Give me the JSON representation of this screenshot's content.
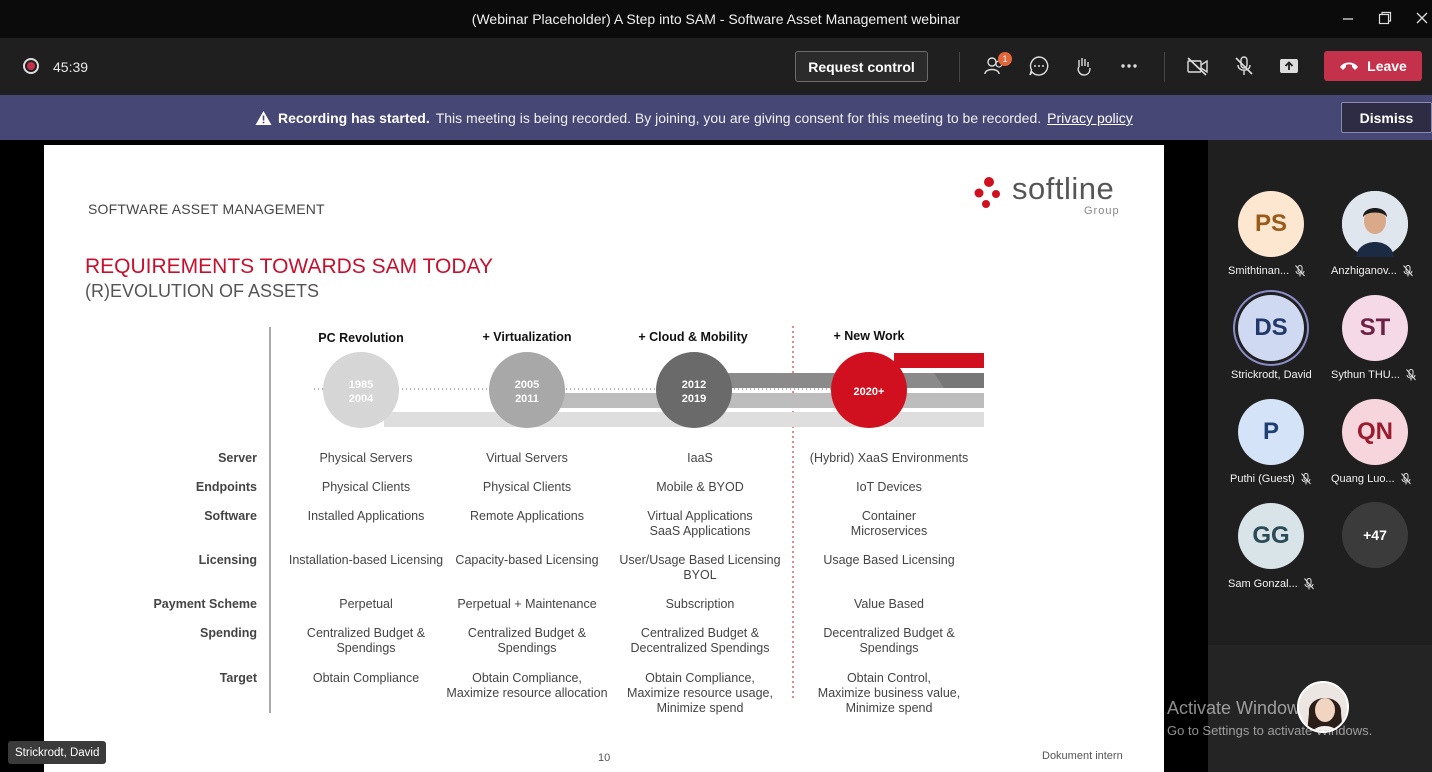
{
  "window": {
    "title": "(Webinar Placeholder) A Step into SAM - Software Asset Management webinar"
  },
  "toolbar": {
    "timer": "45:39",
    "request_control": "Request control",
    "participants_badge": "1",
    "leave": "Leave"
  },
  "banner": {
    "bold": "Recording has started.",
    "text": "This meeting is being recorded. By joining, you are giving consent for this meeting to be recorded.",
    "privacy": "Privacy policy",
    "dismiss": "Dismiss"
  },
  "slide": {
    "header": "SOFTWARE ASSET MANAGEMENT",
    "logo_word": "softline",
    "logo_sub": "Group",
    "title": "REQUIREMENTS TOWARDS SAM TODAY",
    "subtitle": "(R)EVOLUTION OF ASSETS",
    "eras": [
      {
        "head": "PC Revolution",
        "years": [
          "1985",
          "2004"
        ],
        "color": "#d6d6d6"
      },
      {
        "head": "+ Virtualization",
        "years": [
          "2005",
          "2011"
        ],
        "color": "#a8a8a8"
      },
      {
        "head": "+ Cloud & Mobility",
        "years": [
          "2012",
          "2019"
        ],
        "color": "#6a6a6a"
      },
      {
        "head": "+ New Work",
        "years": [
          "2020+"
        ],
        "color": "#d0101e"
      }
    ],
    "rows": [
      {
        "label": "Server",
        "cells": [
          [
            "Physical Servers"
          ],
          [
            "Virtual Servers"
          ],
          [
            "IaaS"
          ],
          [
            "(Hybrid) XaaS Environments"
          ]
        ]
      },
      {
        "label": "Endpoints",
        "cells": [
          [
            "Physical Clients"
          ],
          [
            "Physical Clients"
          ],
          [
            "Mobile & BYOD"
          ],
          [
            "IoT Devices"
          ]
        ]
      },
      {
        "label": "Software",
        "cells": [
          [
            "Installed Applications"
          ],
          [
            "Remote Applications"
          ],
          [
            "Virtual Applications",
            "SaaS Applications"
          ],
          [
            "Container",
            "Microservices"
          ]
        ]
      },
      {
        "label": "Licensing",
        "cells": [
          [
            "Installation-based Licensing"
          ],
          [
            "Capacity-based Licensing"
          ],
          [
            "User/Usage Based Licensing",
            "BYOL"
          ],
          [
            "Usage Based Licensing"
          ]
        ]
      },
      {
        "label": "Payment Scheme",
        "cells": [
          [
            "Perpetual"
          ],
          [
            "Perpetual + Maintenance"
          ],
          [
            "Subscription"
          ],
          [
            "Value Based"
          ]
        ]
      },
      {
        "label": "Spending",
        "cells": [
          [
            "Centralized Budget & Spendings"
          ],
          [
            "Centralized Budget &",
            "Spendings"
          ],
          [
            "Centralized Budget &",
            "Decentralized Spendings"
          ],
          [
            "Decentralized Budget &",
            "Spendings"
          ]
        ]
      },
      {
        "label": "Target",
        "cells": [
          [
            "Obtain Compliance"
          ],
          [
            "Obtain Compliance,",
            "Maximize resource allocation"
          ],
          [
            "Obtain Compliance,",
            "Maximize resource usage,",
            "Minimize spend"
          ],
          [
            "Obtain Control,",
            "Maximize business value,",
            "Minimize spend"
          ]
        ]
      }
    ],
    "page_number": "10",
    "footer": "Dokument intern",
    "presenter": "Strickrodt, David"
  },
  "participants": [
    {
      "initials": "PS",
      "name": "Smithtinan...",
      "bg": "#fde7d0",
      "fg": "#9a5a1a",
      "photo": false,
      "muted": true
    },
    {
      "initials": "",
      "name": "Anzhiganov...",
      "bg": "#dfe6ee",
      "fg": "#333",
      "photo": true,
      "muted": true
    },
    {
      "initials": "DS",
      "name": "Strickrodt, David",
      "bg": "#cfd9f2",
      "fg": "#22386b",
      "photo": false,
      "muted": false,
      "speaking": true
    },
    {
      "initials": "ST",
      "name": "Sythun THU...",
      "bg": "#f5d9e6",
      "fg": "#6b2145",
      "photo": false,
      "muted": true
    },
    {
      "initials": "P",
      "name": "Puthi (Guest)",
      "bg": "#d4e3f7",
      "fg": "#1f3f73",
      "photo": false,
      "muted": true
    },
    {
      "initials": "QN",
      "name": "Quang Luo...",
      "bg": "#f6d6dc",
      "fg": "#9b1c2e",
      "photo": false,
      "muted": true
    },
    {
      "initials": "GG",
      "name": "Sam Gonzal...",
      "bg": "#d8e4e8",
      "fg": "#2b4b56",
      "photo": false,
      "muted": true
    }
  ],
  "overflow": "+47",
  "watermark": {
    "line1": "Activate Windows",
    "line2": "Go to Settings to activate Windows."
  }
}
